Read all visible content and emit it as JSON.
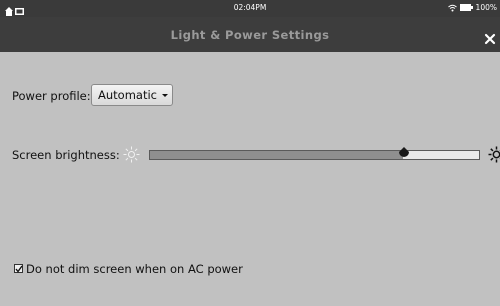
{
  "status_bar": {
    "time": "02:04PM",
    "battery_text": "100%"
  },
  "header": {
    "title": "Light & Power Settings"
  },
  "settings": {
    "power_profile": {
      "label": "Power profile:",
      "selected": "Automatic"
    },
    "screen_brightness": {
      "label": "Screen brightness:",
      "level": 0.77
    },
    "dim_on_ac": {
      "label": "Do not dim screen when on AC power",
      "checked": true
    }
  }
}
